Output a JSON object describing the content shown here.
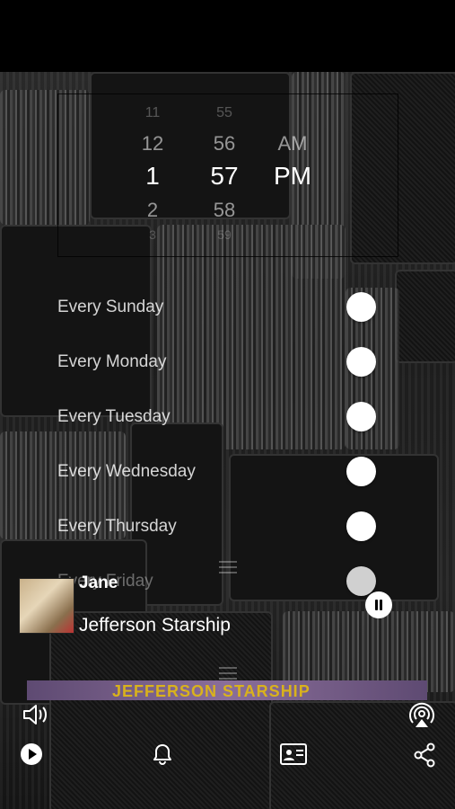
{
  "picker": {
    "hours": [
      "11",
      "12",
      "1",
      "2",
      "3"
    ],
    "minutes": [
      "55",
      "56",
      "57",
      "58",
      "59"
    ],
    "periods": [
      "AM",
      "PM"
    ]
  },
  "schedule": {
    "days": [
      {
        "label": "Every Sunday",
        "enabled": true
      },
      {
        "label": "Every Monday",
        "enabled": true
      },
      {
        "label": "Every Tuesday",
        "enabled": true
      },
      {
        "label": "Every Wednesday",
        "enabled": true
      },
      {
        "label": "Every Thursday",
        "enabled": true
      },
      {
        "label": "Every Friday",
        "enabled": true
      }
    ]
  },
  "now_playing": {
    "title": "Jane",
    "artist": "Jefferson Starship",
    "banner_text": "JEFFERSON STARSHIP"
  },
  "icons": {
    "volume": "speaker-icon",
    "airplay": "airplay-icon",
    "play": "play-circle-icon",
    "alarm": "bell-icon",
    "contact": "contact-card-icon",
    "share": "share-icon"
  }
}
